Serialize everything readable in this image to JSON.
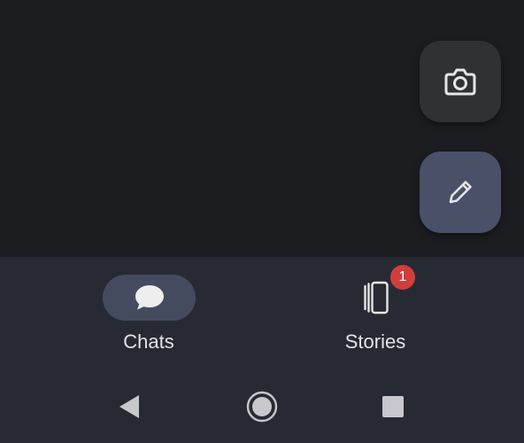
{
  "fabs": {
    "camera_icon": "camera-icon",
    "compose_icon": "pencil-icon"
  },
  "bottom_nav": {
    "items": [
      {
        "label": "Chats",
        "icon": "chat-bubble-icon",
        "active": true
      },
      {
        "label": "Stories",
        "icon": "stories-icon",
        "active": false,
        "badge": "1"
      }
    ]
  },
  "system_nav": {
    "buttons": [
      "back-icon",
      "home-icon",
      "recents-icon"
    ]
  },
  "colors": {
    "background": "#1c1d20",
    "nav_background": "#282a33",
    "active_pill": "#454b5f",
    "compose_fab": "#4a5068",
    "camera_fab": "#303134",
    "badge": "#d23e3b"
  }
}
